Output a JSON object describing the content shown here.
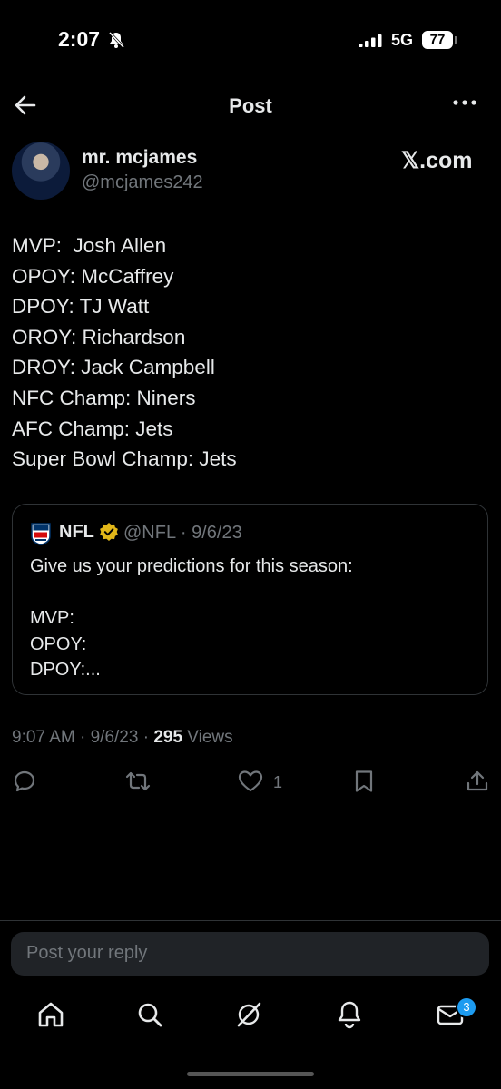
{
  "status_bar": {
    "time": "2:07",
    "network": "5G",
    "battery": "77"
  },
  "header": {
    "title": "Post"
  },
  "post": {
    "author_name": "mr. mcjames",
    "author_handle": "@mcjames242",
    "watermark": "𝕏.com",
    "lines": [
      "MVP:  Josh Allen",
      "OPOY: McCaffrey",
      "DPOY: TJ Watt",
      "OROY: Richardson",
      "DROY: Jack Campbell",
      "NFC Champ: Niners",
      "AFC Champ: Jets",
      "Super Bowl Champ: Jets"
    ],
    "quote": {
      "name": "NFL",
      "meta": "@NFL · 9/6/23",
      "text": "Give us your predictions for this season:\n\nMVP:\nOPOY:\nDPOY:..."
    },
    "timestamp": "9:07 AM · 9/6/23 · ",
    "views_count": "295",
    "views_label": " Views",
    "like_count": "1"
  },
  "reply": {
    "placeholder": "Post your reply"
  },
  "tabbar": {
    "messages_badge": "3"
  },
  "colors": {
    "background": "#000000",
    "text": "#e7e9ea",
    "muted": "#71767b",
    "accent": "#1d9bf0",
    "verified": "#e2b719"
  },
  "icons": [
    "back-arrow-icon",
    "more-icon",
    "reply-icon",
    "repost-icon",
    "like-icon",
    "bookmark-icon",
    "share-icon",
    "home-icon",
    "search-icon",
    "grok-icon",
    "notifications-icon",
    "messages-icon"
  ]
}
